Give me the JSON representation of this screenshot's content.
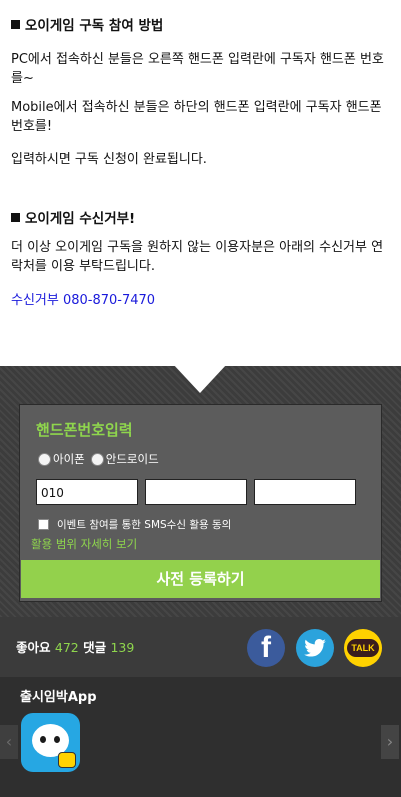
{
  "info": {
    "section1_title": "오이게임 구독 참여 방법",
    "pc_text": "PC에서 접속하신 분들은 오른쪽 핸드폰 입력란에 구독자 핸드폰 번호를~",
    "mobile_text": "Mobile에서 접속하신 분들은 하단의 핸드폰 입력란에 구독자 핸드폰 번호를!",
    "complete_text": "입력하시면 구독 신청이 완료됩니다.",
    "section2_title": "오이게임 수신거부!",
    "reject_text": "더 이상 오이게임 구독을 원하지 않는 이용자분은 아래의 수신거부 연락처를 이용 부탁드립니다.",
    "reject_contact": "수신거부 080-870-7470"
  },
  "form": {
    "title": "핸드폰번호입력",
    "radio_iphone": "아이폰",
    "radio_android": "안드로이드",
    "phone_prefix": "010",
    "phone_mid": "",
    "phone_last": "",
    "agree_label": "이벤트 참여를 통한 SMS수신 활용 동의",
    "detail_link": "활용 범위 자세히 보기",
    "submit_label": "사전 등록하기"
  },
  "social": {
    "likes_label": "좋아요",
    "likes_count": "472",
    "comments_label": "댓글",
    "comments_count": "139",
    "facebook_glyph": "f",
    "talk_label": "TALK"
  },
  "apps": {
    "title": "출시임박App",
    "left_arrow": "‹",
    "right_arrow": "›"
  },
  "colors": {
    "accent_green": "#8fd64d",
    "button_green": "#93d14c",
    "link_blue": "#1a1adb"
  }
}
